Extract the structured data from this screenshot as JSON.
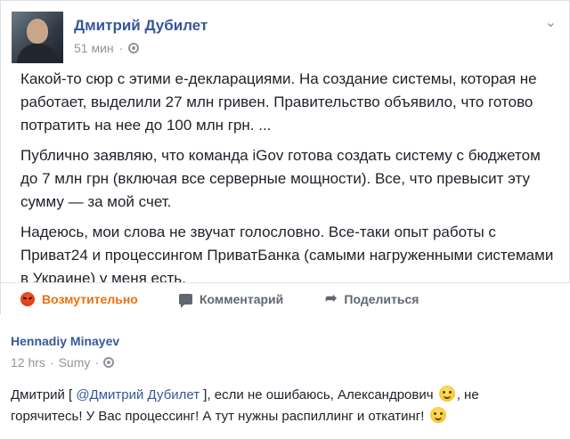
{
  "post": {
    "author": "Дмитрий Дубилет",
    "time": "51 мин",
    "privacy_icon": "globe-icon",
    "paragraphs": [
      "Какой-то сюр с этими е-декларациями. На создание системы, которая не работает, выделили 27 млн гривен. Правительство объявило, что готово потратить на нее до 100 млн грн. ...",
      "Публично заявляю, что команда iGov готова создать систему с бюджетом до 7 млн грн (включая все серверные мощности). Все, что превысит эту сумму — за мой счет.",
      "Надеюсь, мои слова не звучат голословно. Все-таки опыт работы с Приват24 и процессингом ПриватБанка (самыми нагруженными системами в Украине) у меня есть."
    ],
    "actions": {
      "reaction_label": "Возмутительно",
      "comment_label": "Комментарий",
      "share_label": "Поделиться"
    }
  },
  "comment": {
    "author": "Hennadiy Minayev",
    "time": "12 hrs",
    "location": "Sumy",
    "text_prefix": "Дмитрий [ ",
    "mention": "@Дмитрий Дубилет",
    "text_middle": " ], если не ошибаюсь, Александрович ",
    "text_suffix": ", не горячитесь! У Вас процессинг! А тут нужны распиллинг и откатинг! "
  },
  "colors": {
    "link": "#365899",
    "meta": "#90949c",
    "angry": "#e9710f",
    "text": "#1d2129"
  }
}
